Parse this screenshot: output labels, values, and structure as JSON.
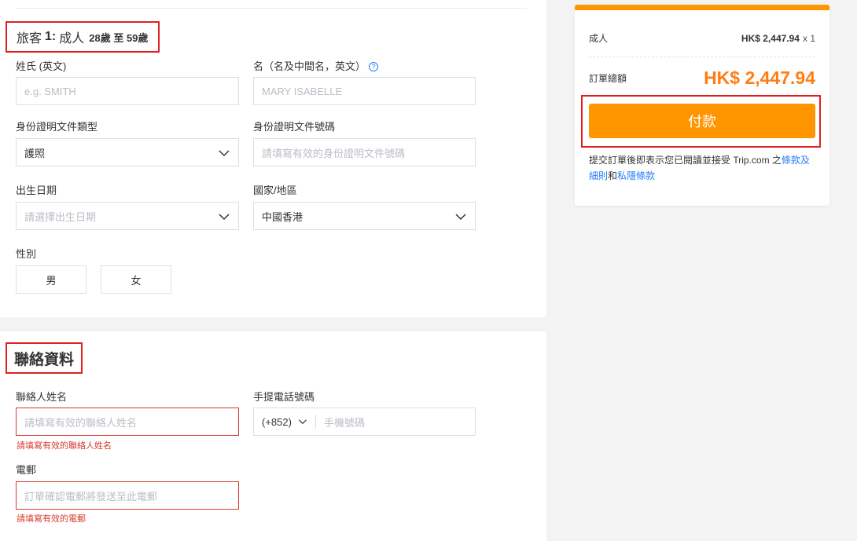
{
  "traveler": {
    "title_prefix": "旅客",
    "title_num": "1:",
    "title_type": "成人",
    "title_age": "28歲 至 59歲",
    "surname_label": "姓氏 (英文)",
    "surname_placeholder": "e.g. SMITH",
    "given_label": "名（名及中間名，英文）",
    "given_placeholder": "MARY ISABELLE",
    "help_glyph": "?",
    "id_type_label": "身份證明文件類型",
    "id_type_value": "護照",
    "id_number_label": "身份證明文件號碼",
    "id_number_placeholder": "請填寫有效的身份證明文件號碼",
    "dob_label": "出生日期",
    "dob_placeholder": "請選擇出生日期",
    "region_label": "國家/地區",
    "region_value": "中國香港",
    "gender_label": "性別",
    "gender_male": "男",
    "gender_female": "女"
  },
  "contact": {
    "title": "聯絡資料",
    "name_label": "聯絡人姓名",
    "name_placeholder": "請填寫有效的聯絡人姓名",
    "name_error": "請填寫有效的聯絡人姓名",
    "phone_label": "手提電話號碼",
    "phone_code": "(+852)",
    "phone_placeholder": "手機號碼",
    "email_label": "電郵",
    "email_placeholder": "訂單確認電郵將發送至此電郵",
    "email_error": "請填寫有效的電郵"
  },
  "summary": {
    "adult_label": "成人",
    "adult_price": "HK$ 2,447.94",
    "adult_qty": "x 1",
    "total_label": "訂單總額",
    "total_value": "HK$ 2,447.94",
    "pay_label": "付款",
    "terms_prefix": "提交訂單後即表示您已閱讀並接受 Trip.com 之",
    "terms_link": "條款及細則",
    "terms_and": "和",
    "privacy_link": "私隱條款"
  },
  "colors": {
    "accent": "#ff9500",
    "total": "#ff7d13",
    "error": "#d63b2f",
    "link": "#287dfa",
    "highlight_box": "#e02020"
  },
  "icons": [
    "chevron-down-icon",
    "help-icon"
  ]
}
